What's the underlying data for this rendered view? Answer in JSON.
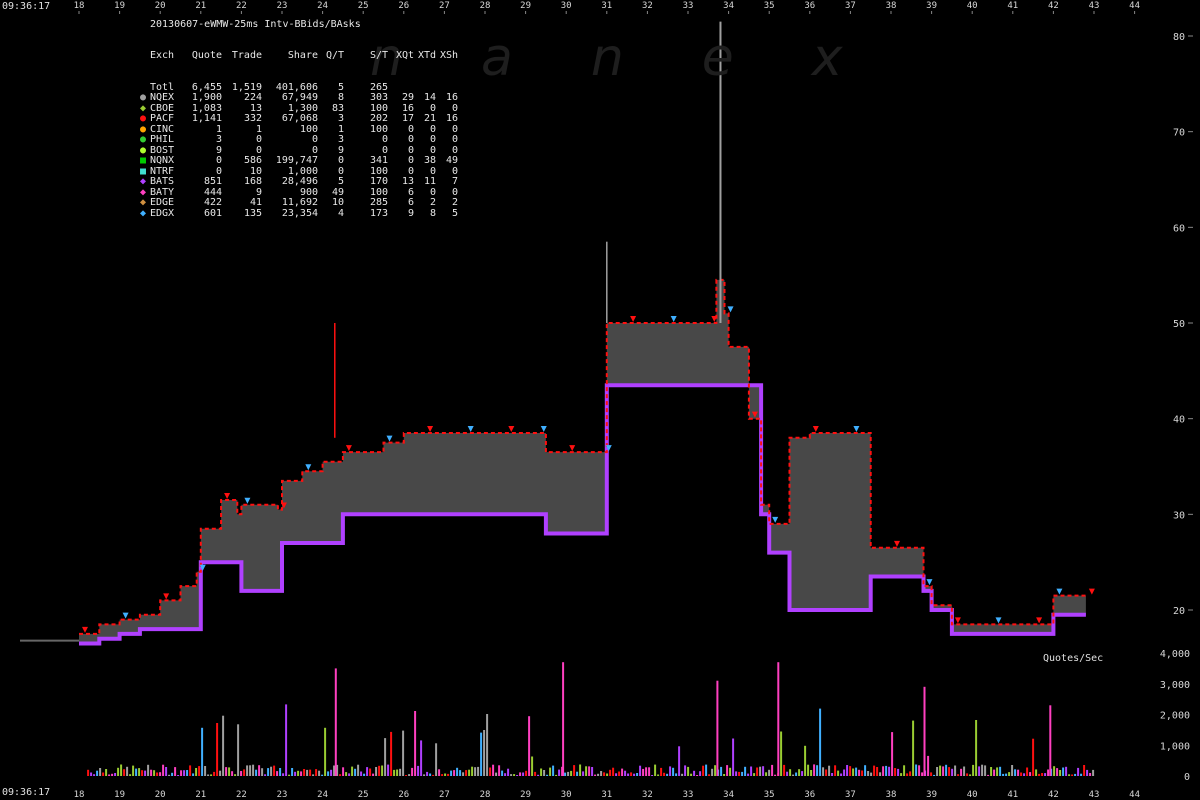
{
  "title": "20130607-eWMW-25ms Intv-BBids/BAsks",
  "start_time": "09:36:17",
  "volume_label": "Quotes/Sec",
  "watermark": "nanex",
  "legend": {
    "headers": [
      "Exch",
      "Quote",
      "Trade",
      "Share",
      "Q/T",
      "S/T",
      "XQt",
      "XTd",
      "XSh"
    ],
    "rows": [
      {
        "name": "Totl",
        "quote": "6,455",
        "trade": "1,519",
        "share": "401,606",
        "qt": "5",
        "st": "265",
        "xqt": "",
        "xtd": "",
        "xsh": "",
        "color": "",
        "marker": ""
      },
      {
        "name": "NQEX",
        "quote": "1,900",
        "trade": "224",
        "share": "67,949",
        "qt": "8",
        "st": "303",
        "xqt": "29",
        "xtd": "14",
        "xsh": "16",
        "color": "#a0a0a0",
        "marker": "●"
      },
      {
        "name": "CBOE",
        "quote": "1,083",
        "trade": "13",
        "share": "1,300",
        "qt": "83",
        "st": "100",
        "xqt": "16",
        "xtd": "0",
        "xsh": "0",
        "color": "#9acd32",
        "marker": "◆"
      },
      {
        "name": "PACF",
        "quote": "1,141",
        "trade": "332",
        "share": "67,068",
        "qt": "3",
        "st": "202",
        "xqt": "17",
        "xtd": "21",
        "xsh": "16",
        "color": "#ff1010",
        "marker": "●"
      },
      {
        "name": "CINC",
        "quote": "1",
        "trade": "1",
        "share": "100",
        "qt": "1",
        "st": "100",
        "xqt": "0",
        "xtd": "0",
        "xsh": "0",
        "color": "#ffa500",
        "marker": "●"
      },
      {
        "name": "PHIL",
        "quote": "3",
        "trade": "0",
        "share": "0",
        "qt": "3",
        "st": "0",
        "xqt": "0",
        "xtd": "0",
        "xsh": "0",
        "color": "#32cd32",
        "marker": "●"
      },
      {
        "name": "BOST",
        "quote": "9",
        "trade": "0",
        "share": "0",
        "qt": "9",
        "st": "0",
        "xqt": "0",
        "xtd": "0",
        "xsh": "0",
        "color": "#adff2f",
        "marker": "●"
      },
      {
        "name": "NQNX",
        "quote": "0",
        "trade": "586",
        "share": "199,747",
        "qt": "0",
        "st": "341",
        "xqt": "0",
        "xtd": "38",
        "xsh": "49",
        "color": "#00cc00",
        "marker": "■"
      },
      {
        "name": "NTRF",
        "quote": "0",
        "trade": "10",
        "share": "1,000",
        "qt": "0",
        "st": "100",
        "xqt": "0",
        "xtd": "0",
        "xsh": "0",
        "color": "#40e0d0",
        "marker": "■"
      },
      {
        "name": "BATS",
        "quote": "851",
        "trade": "168",
        "share": "28,496",
        "qt": "5",
        "st": "170",
        "xqt": "13",
        "xtd": "11",
        "xsh": "7",
        "color": "#b040ff",
        "marker": "◆"
      },
      {
        "name": "BATY",
        "quote": "444",
        "trade": "9",
        "share": "900",
        "qt": "49",
        "st": "100",
        "xqt": "6",
        "xtd": "0",
        "xsh": "0",
        "color": "#ff40c0",
        "marker": "◆"
      },
      {
        "name": "EDGE",
        "quote": "422",
        "trade": "41",
        "share": "11,692",
        "qt": "10",
        "st": "285",
        "xqt": "6",
        "xtd": "2",
        "xsh": "2",
        "color": "#d09040",
        "marker": "◆"
      },
      {
        "name": "EDGX",
        "quote": "601",
        "trade": "135",
        "share": "23,354",
        "qt": "4",
        "st": "173",
        "xqt": "9",
        "xtd": "8",
        "xsh": "5",
        "color": "#40b0ff",
        "marker": "◆"
      }
    ]
  },
  "chart_data": {
    "type": "area",
    "x_ticks": [
      "18",
      "19",
      "20",
      "21",
      "22",
      "23",
      "24",
      "25",
      "26",
      "27",
      "28",
      "29",
      "30",
      "31",
      "32",
      "33",
      "34",
      "35",
      "36",
      "37",
      "38",
      "39",
      "40",
      "41",
      "42",
      "43",
      "44"
    ],
    "x_range": [
      18,
      44
    ],
    "price_axis": {
      "ticks": [
        20,
        30,
        40,
        50,
        60,
        70,
        80
      ],
      "range": [
        14,
        82
      ]
    },
    "volume_axis": {
      "tick_labels": [
        "0",
        "1,000",
        "2,000",
        "3,000",
        "4,000"
      ],
      "ticks": [
        0,
        1000,
        2000,
        3000,
        4000
      ],
      "range": [
        0,
        4000
      ]
    },
    "colors": {
      "spread": "#484848",
      "bid": "#b040ff",
      "ask": "#ff1010",
      "trade": "#a0a0a0",
      "bids_alt": "#40b0ff",
      "quote_bid": "#9acd32"
    },
    "series": [
      {
        "x": [
          18.0,
          18.5,
          19.0,
          19.5,
          20.0,
          20.5,
          20.9,
          21.0,
          21.5,
          21.9,
          22.0,
          22.5,
          22.9,
          23.0,
          23.5,
          24.0,
          24.5,
          25.0,
          25.5,
          26.0,
          26.5,
          27.0,
          27.5,
          28.0,
          28.5,
          29.0,
          29.3,
          29.5,
          30.0,
          30.5,
          30.9,
          31.0,
          31.5,
          32.0,
          32.5,
          33.0,
          33.5,
          33.7,
          33.9,
          34.0,
          34.5,
          34.8,
          35.0,
          35.5,
          36.0,
          36.5,
          37.0,
          37.5,
          38.0,
          38.5,
          38.8,
          39.0,
          39.5,
          40.0,
          40.5,
          41.0,
          41.5,
          41.9,
          42.0,
          42.5,
          42.8
        ],
        "bid": [
          16.5,
          17.0,
          17.5,
          18.0,
          18.0,
          18.0,
          18.0,
          25.0,
          25.0,
          25.0,
          22.0,
          22.0,
          22.0,
          27.0,
          27.0,
          27.0,
          30.0,
          30.0,
          30.0,
          30.0,
          30.0,
          30.0,
          30.0,
          30.0,
          30.0,
          30.0,
          30.0,
          28.0,
          28.0,
          28.0,
          28.0,
          43.5,
          43.5,
          43.5,
          43.5,
          43.5,
          43.5,
          43.5,
          43.5,
          43.5,
          43.5,
          30.0,
          26.0,
          20.0,
          20.0,
          20.0,
          20.0,
          23.5,
          23.5,
          23.5,
          22.0,
          20.0,
          17.5,
          17.5,
          17.5,
          17.5,
          17.5,
          17.5,
          19.5,
          19.5,
          19.5
        ],
        "ask": [
          17.5,
          18.5,
          19.0,
          19.5,
          21.0,
          22.5,
          24.0,
          28.5,
          31.5,
          30.0,
          31.0,
          31.0,
          30.5,
          33.5,
          34.5,
          35.5,
          36.5,
          36.5,
          37.5,
          38.5,
          38.5,
          38.5,
          38.5,
          38.5,
          38.5,
          38.5,
          38.5,
          36.5,
          36.5,
          36.5,
          36.5,
          50.0,
          50.0,
          50.0,
          50.0,
          50.0,
          50.0,
          54.5,
          51.0,
          47.5,
          40.0,
          31.0,
          29.0,
          38.0,
          38.5,
          38.5,
          38.5,
          26.5,
          26.5,
          26.5,
          22.5,
          20.5,
          18.5,
          18.5,
          18.5,
          18.5,
          18.5,
          18.5,
          21.5,
          21.5,
          21.5
        ]
      }
    ]
  }
}
